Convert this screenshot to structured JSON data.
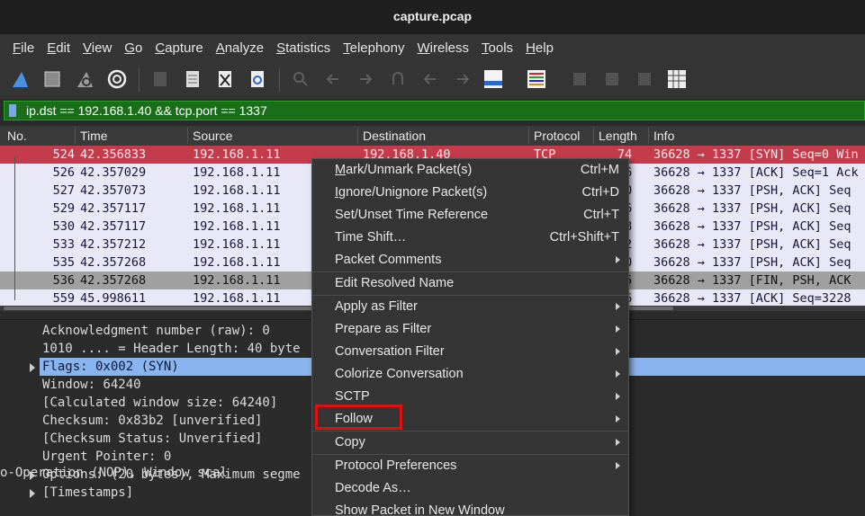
{
  "window": {
    "title": "capture.pcap"
  },
  "menubar": [
    "File",
    "Edit",
    "View",
    "Go",
    "Capture",
    "Analyze",
    "Statistics",
    "Telephony",
    "Wireless",
    "Tools",
    "Help"
  ],
  "menubar_mnemonics": [
    "F",
    "E",
    "V",
    "G",
    "C",
    "A",
    "S",
    "T",
    "W",
    "T",
    "H"
  ],
  "toolbar": [
    "start-capture-icon",
    "stop-capture-icon",
    "restart-capture-icon",
    "capture-options-icon",
    "open-file-icon",
    "save-file-icon",
    "close-file-icon",
    "reload-file-icon",
    "find-packet-icon",
    "go-back-icon",
    "go-forward-icon",
    "go-to-packet-icon",
    "go-first-icon",
    "go-last-icon",
    "auto-scroll-icon",
    "colorize-icon",
    "zoom-in-icon",
    "zoom-out-icon",
    "normal-size-icon",
    "resize-columns-icon"
  ],
  "filter": {
    "expression": "ip.dst == 192.168.1.40 && tcp.port == 1337",
    "color": "#1a6e1a"
  },
  "packet_list": {
    "columns": [
      "No.",
      "Time",
      "Source",
      "Destination",
      "Protocol",
      "Length",
      "Info"
    ],
    "rows": [
      {
        "no": "524",
        "time": "42.356833",
        "source": "192.168.1.11",
        "destination": "192.168.1.40",
        "protocol": "TCP",
        "length": "74",
        "info": "36628 → 1337 [SYN] Seq=0 Win",
        "style": "syn"
      },
      {
        "no": "526",
        "time": "42.357029",
        "source": "192.168.1.11",
        "destination": "",
        "protocol": "",
        "length": "66",
        "info": "36628 → 1337 [ACK] Seq=1 Ack",
        "style": "normal"
      },
      {
        "no": "527",
        "time": "42.357073",
        "source": "192.168.1.11",
        "destination": "",
        "protocol": "",
        "length": "90",
        "info": "36628 → 1337 [PSH, ACK] Seq",
        "style": "normal"
      },
      {
        "no": "529",
        "time": "42.357117",
        "source": "192.168.1.11",
        "destination": "",
        "protocol": "",
        "length": "06",
        "info": "36628 → 1337 [PSH, ACK] Seq",
        "style": "normal"
      },
      {
        "no": "530",
        "time": "42.357117",
        "source": "192.168.1.11",
        "destination": "",
        "protocol": "",
        "length": "58",
        "info": "36628 → 1337 [PSH, ACK] Seq",
        "style": "normal"
      },
      {
        "no": "533",
        "time": "42.357212",
        "source": "192.168.1.11",
        "destination": "",
        "protocol": "",
        "length": "62",
        "info": "36628 → 1337 [PSH, ACK] Seq",
        "style": "normal"
      },
      {
        "no": "535",
        "time": "42.357268",
        "source": "192.168.1.11",
        "destination": "",
        "protocol": "",
        "length": "50",
        "info": "36628 → 1337 [PSH, ACK] Seq",
        "style": "normal"
      },
      {
        "no": "536",
        "time": "42.357268",
        "source": "192.168.1.11",
        "destination": "",
        "protocol": "",
        "length": "15",
        "info": "36628 → 1337 [FIN, PSH, ACK",
        "style": "fin"
      },
      {
        "no": "559",
        "time": "45.998611",
        "source": "192.168.1.11",
        "destination": "",
        "protocol": "",
        "length": "66",
        "info": "36628 → 1337 [ACK] Seq=3228",
        "style": "normal"
      }
    ]
  },
  "details": [
    {
      "text": "Acknowledgment number (raw): 0",
      "expandable": false,
      "selected": false
    },
    {
      "text": "1010 .... = Header Length: 40 byte",
      "expandable": false,
      "selected": false
    },
    {
      "text": "Flags: 0x002 (SYN)",
      "expandable": true,
      "selected": true
    },
    {
      "text": "Window: 64240",
      "expandable": false,
      "selected": false
    },
    {
      "text": "[Calculated window size: 64240]",
      "expandable": false,
      "selected": false
    },
    {
      "text": "Checksum: 0x83b2 [unverified]",
      "expandable": false,
      "selected": false
    },
    {
      "text": "[Checksum Status: Unverified]",
      "expandable": false,
      "selected": false
    },
    {
      "text": "Urgent Pointer: 0",
      "expandable": false,
      "selected": false
    },
    {
      "text": "Options: (20 bytes), Maximum segme",
      "tail": "o-Operation (NOP), Window scal",
      "expandable": true,
      "selected": false
    },
    {
      "text": "[Timestamps]",
      "expandable": true,
      "selected": false
    }
  ],
  "context_menu": {
    "items": [
      {
        "label": "Mark/Unmark Packet(s)",
        "mnemonic": "M",
        "shortcut": "Ctrl+M",
        "submenu": false
      },
      {
        "label": "Ignore/Unignore Packet(s)",
        "mnemonic": "I",
        "shortcut": "Ctrl+D",
        "submenu": false
      },
      {
        "label": "Set/Unset Time Reference",
        "mnemonic": "",
        "shortcut": "Ctrl+T",
        "submenu": false
      },
      {
        "label": "Time Shift…",
        "mnemonic": "",
        "shortcut": "Ctrl+Shift+T",
        "submenu": false
      },
      {
        "label": "Packet Comments",
        "mnemonic": "",
        "shortcut": "",
        "submenu": true
      },
      {
        "sep": true
      },
      {
        "label": "Edit Resolved Name",
        "mnemonic": "",
        "shortcut": "",
        "submenu": false
      },
      {
        "sep": true
      },
      {
        "label": "Apply as Filter",
        "mnemonic": "",
        "shortcut": "",
        "submenu": true
      },
      {
        "label": "Prepare as Filter",
        "mnemonic": "",
        "shortcut": "",
        "submenu": true
      },
      {
        "label": "Conversation Filter",
        "mnemonic": "",
        "shortcut": "",
        "submenu": true
      },
      {
        "label": "Colorize Conversation",
        "mnemonic": "",
        "shortcut": "",
        "submenu": true
      },
      {
        "label": "SCTP",
        "mnemonic": "",
        "shortcut": "",
        "submenu": true
      },
      {
        "label": "Follow",
        "mnemonic": "",
        "shortcut": "",
        "submenu": true,
        "highlighted": true
      },
      {
        "sep": true
      },
      {
        "label": "Copy",
        "mnemonic": "",
        "shortcut": "",
        "submenu": true
      },
      {
        "sep": true
      },
      {
        "label": "Protocol Preferences",
        "mnemonic": "",
        "shortcut": "",
        "submenu": true
      },
      {
        "label": "Decode As…",
        "mnemonic": "",
        "shortcut": "",
        "submenu": false
      },
      {
        "label": "Show Packet in New Window",
        "mnemonic": "",
        "shortcut": "",
        "submenu": false
      }
    ]
  },
  "colors": {
    "syn_row": "#c43c4c",
    "fin_row": "#a0a0a0",
    "list_bg": "#e8e8f6",
    "selected_detail": "#8ab4ee",
    "highlight_box": "#e01010"
  }
}
